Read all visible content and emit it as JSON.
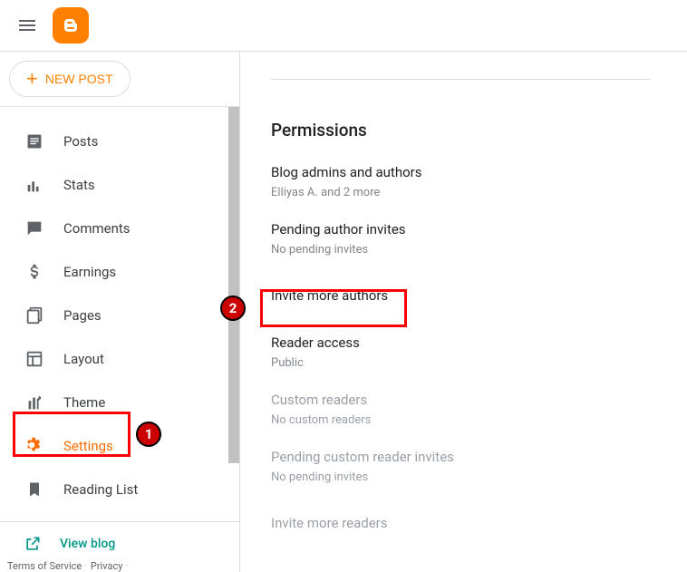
{
  "newpost_label": "NEW POST",
  "nav": [
    {
      "key": "posts",
      "label": "Posts"
    },
    {
      "key": "stats",
      "label": "Stats"
    },
    {
      "key": "comments",
      "label": "Comments"
    },
    {
      "key": "earnings",
      "label": "Earnings"
    },
    {
      "key": "pages",
      "label": "Pages"
    },
    {
      "key": "layout",
      "label": "Layout"
    },
    {
      "key": "theme",
      "label": "Theme"
    },
    {
      "key": "settings",
      "label": "Settings"
    },
    {
      "key": "reading_list",
      "label": "Reading List"
    }
  ],
  "view_blog_label": "View blog",
  "footer": {
    "terms": "Terms of Service",
    "privacy": "Privacy"
  },
  "section_title": "Permissions",
  "rows": {
    "admins": {
      "label": "Blog admins and authors",
      "value": "Elliyas A. and 2 more"
    },
    "pending_authors": {
      "label": "Pending author invites",
      "value": "No pending invites"
    },
    "invite_authors": {
      "label": "Invite more authors"
    },
    "reader_access": {
      "label": "Reader access",
      "value": "Public"
    },
    "custom_readers": {
      "label": "Custom readers",
      "value": "No custom readers"
    },
    "pending_readers": {
      "label": "Pending custom reader invites",
      "value": "No pending invites"
    },
    "invite_readers": {
      "label": "Invite more readers"
    }
  },
  "annotations": {
    "step1": "1",
    "step2": "2"
  }
}
